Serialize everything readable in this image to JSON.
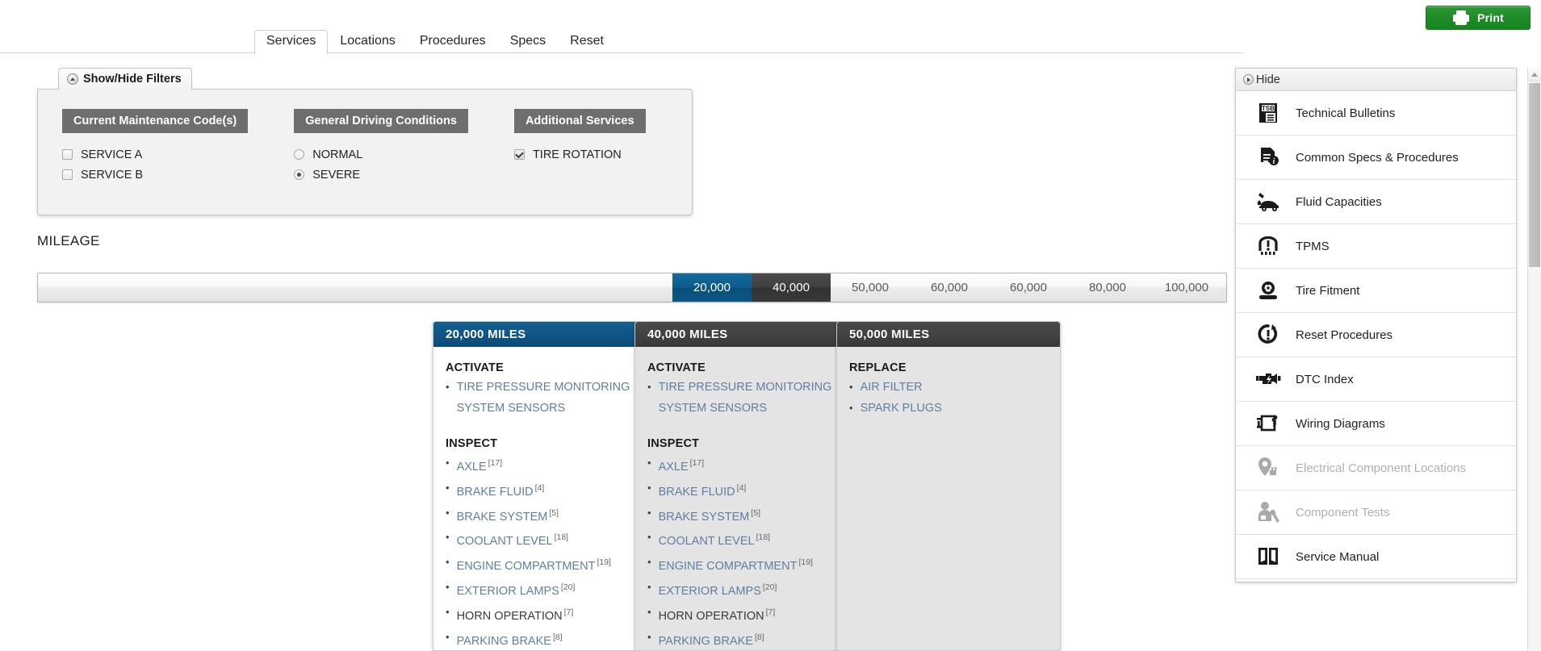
{
  "toolbar": {
    "print_label": "Print",
    "print_icon": "printer-icon",
    "print_color": "#1f8a27"
  },
  "tabs": [
    {
      "label": "Services",
      "active": true
    },
    {
      "label": "Locations",
      "active": false
    },
    {
      "label": "Procedures",
      "active": false
    },
    {
      "label": "Specs",
      "active": false
    },
    {
      "label": "Reset",
      "active": false
    }
  ],
  "filters": {
    "toggle_label": "Show/Hide Filters",
    "toggle_icon": "circle-triangle-up-icon",
    "groups": [
      {
        "title": "Current Maintenance Code(s)",
        "type": "checkbox",
        "options": [
          {
            "label": "SERVICE A",
            "checked": false
          },
          {
            "label": "SERVICE B",
            "checked": false
          }
        ]
      },
      {
        "title": "General Driving Conditions",
        "type": "radio",
        "options": [
          {
            "label": "NORMAL",
            "checked": false
          },
          {
            "label": "SEVERE",
            "checked": true
          }
        ]
      },
      {
        "title": "Additional Services",
        "type": "checkbox",
        "options": [
          {
            "label": "TIRE ROTATION",
            "checked": true
          }
        ]
      }
    ]
  },
  "mileage": {
    "section_label": "MILEAGE",
    "segments": [
      {
        "label": "20,000",
        "state": "selected-blue"
      },
      {
        "label": "40,000",
        "state": "selected-dark"
      },
      {
        "label": "50,000",
        "state": "normal"
      },
      {
        "label": "60,000",
        "state": "normal"
      },
      {
        "label": "60,000",
        "state": "normal"
      },
      {
        "label": "80,000",
        "state": "normal"
      },
      {
        "label": "100,000",
        "state": "normal"
      }
    ]
  },
  "service_cards": [
    {
      "title": "20,000 MILES",
      "header_style": "blue",
      "body_style": "white",
      "sections": [
        {
          "heading": "ACTIVATE",
          "items": [
            {
              "label": "TIRE PRESSURE MONITORING SYSTEM SENSORS",
              "ref": "",
              "link": true
            }
          ]
        },
        {
          "heading": "INSPECT",
          "items": [
            {
              "label": "AXLE",
              "ref": "17",
              "link": true
            },
            {
              "label": "BRAKE FLUID",
              "ref": "4",
              "link": true
            },
            {
              "label": "BRAKE SYSTEM",
              "ref": "5",
              "link": true
            },
            {
              "label": "COOLANT LEVEL",
              "ref": "18",
              "link": true
            },
            {
              "label": "ENGINE COMPARTMENT",
              "ref": "19",
              "link": true
            },
            {
              "label": "EXTERIOR LAMPS",
              "ref": "20",
              "link": true
            },
            {
              "label": "HORN OPERATION",
              "ref": "7",
              "link": false
            },
            {
              "label": "PARKING BRAKE",
              "ref": "8",
              "link": true
            }
          ]
        }
      ]
    },
    {
      "title": "40,000 MILES",
      "header_style": "dark",
      "body_style": "grey",
      "sections": [
        {
          "heading": "ACTIVATE",
          "items": [
            {
              "label": "TIRE PRESSURE MONITORING SYSTEM SENSORS",
              "ref": "",
              "link": true
            }
          ]
        },
        {
          "heading": "INSPECT",
          "items": [
            {
              "label": "AXLE",
              "ref": "17",
              "link": true
            },
            {
              "label": "BRAKE FLUID",
              "ref": "4",
              "link": true
            },
            {
              "label": "BRAKE SYSTEM",
              "ref": "5",
              "link": true
            },
            {
              "label": "COOLANT LEVEL",
              "ref": "18",
              "link": true
            },
            {
              "label": "ENGINE COMPARTMENT",
              "ref": "19",
              "link": true
            },
            {
              "label": "EXTERIOR LAMPS",
              "ref": "20",
              "link": true
            },
            {
              "label": "HORN OPERATION",
              "ref": "7",
              "link": false
            },
            {
              "label": "PARKING BRAKE",
              "ref": "8",
              "link": true
            }
          ]
        }
      ]
    },
    {
      "title": "50,000 MILES",
      "header_style": "dark",
      "body_style": "grey",
      "sections": [
        {
          "heading": "REPLACE",
          "items": [
            {
              "label": "AIR FILTER",
              "ref": "",
              "link": true
            },
            {
              "label": "SPARK PLUGS",
              "ref": "",
              "link": true
            }
          ]
        }
      ]
    }
  ],
  "right_panel": {
    "hide_label": "Hide",
    "hide_icon": "circle-triangle-right-icon",
    "items": [
      {
        "label": "Technical Bulletins",
        "icon": "tsb-document-icon",
        "disabled": false
      },
      {
        "label": "Common Specs & Procedures",
        "icon": "document-info-icon",
        "disabled": false
      },
      {
        "label": "Fluid Capacities",
        "icon": "car-oil-drip-icon",
        "disabled": false
      },
      {
        "label": "TPMS",
        "icon": "tire-pressure-warning-icon",
        "disabled": false
      },
      {
        "label": "Tire Fitment",
        "icon": "tire-wheel-icon",
        "disabled": false
      },
      {
        "label": "Reset Procedures",
        "icon": "reset-warning-icon",
        "disabled": false
      },
      {
        "label": "DTC Index",
        "icon": "engine-bolt-icon",
        "disabled": false
      },
      {
        "label": "Wiring Diagrams",
        "icon": "wiring-coil-icon",
        "disabled": false
      },
      {
        "label": "Electrical Component Locations",
        "icon": "map-pin-connector-icon",
        "disabled": true
      },
      {
        "label": "Component Tests",
        "icon": "person-wrench-icon",
        "disabled": true
      },
      {
        "label": "Service Manual",
        "icon": "open-book-icon",
        "disabled": false
      }
    ]
  }
}
